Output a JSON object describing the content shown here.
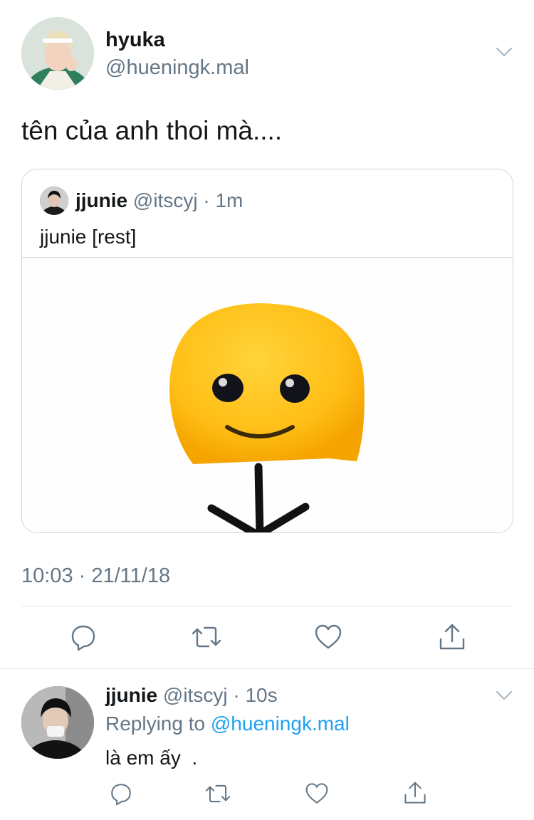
{
  "main_tweet": {
    "display_name": "hyuka",
    "handle": "@hueningk.mal",
    "text": "tên của anh thoi mà....",
    "timestamp": "10:03 · 21/11/18",
    "menu_icon": "chevron-down-icon"
  },
  "quoted_tweet": {
    "display_name": "jjunie",
    "handle": "@itscyj",
    "age": "· 1m",
    "text": "jjunie [rest]",
    "image_description_icon": "smiley-stick-figure"
  },
  "actions": {
    "reply_icon": "reply-icon",
    "retweet_icon": "retweet-icon",
    "like_icon": "heart-icon",
    "share_icon": "share-icon"
  },
  "reply_tweet": {
    "display_name": "jjunie",
    "handle": "@itscyj",
    "age": "· 10s",
    "replying_prefix": "Replying to",
    "replying_handle": "@hueningk.mal",
    "text": "là em ấy  .",
    "menu_icon": "chevron-down-icon"
  },
  "colors": {
    "link": "#1da1f2",
    "muted": "#657786",
    "text": "#14171a",
    "border": "#ccd6dd"
  }
}
